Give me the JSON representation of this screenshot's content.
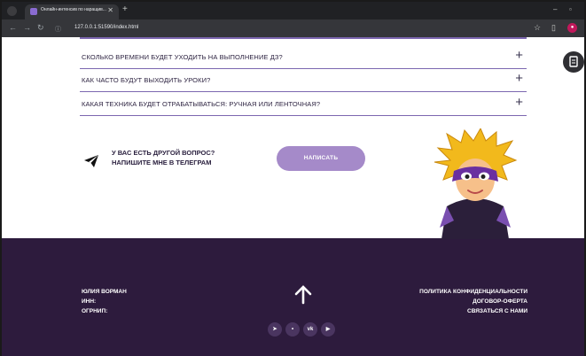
{
  "browser": {
    "tab_title": "Онлайн-интенсив по наращив...",
    "url": "127.0.0.1:51590/index.html"
  },
  "faq": [
    {
      "question": "СКОЛЬКО ВРЕМЕНИ БУДЕТ УХОДИТЬ НА ВЫПОЛНЕНИЕ ДЗ?"
    },
    {
      "question": "КАК ЧАСТО БУДУТ ВЫХОДИТЬ УРОКИ?"
    },
    {
      "question": "КАКАЯ ТЕХНИКА БУДЕТ ОТРАБАТЫВАТЬСЯ: РУЧНАЯ ИЛИ ЛЕНТОЧНАЯ?"
    }
  ],
  "contact": {
    "line1": "У ВАС ЕСТЬ ДРУГОЙ ВОПРОС?",
    "line2": "НАПИШИТЕ МНЕ В ТЕЛЕГРАМ",
    "button": "НАПИСАТЬ"
  },
  "footer": {
    "name": "ЮЛИЯ ВОРМАН",
    "inn": "ИНН:",
    "ogrnip": "ОГРНИП:",
    "links": [
      "ПОЛИТИКА КОНФИДЕНЦИАЛЬНОСТИ",
      "ДОГОВОР-ОФЕРТА",
      "СВЯЗАТЬСЯ С НАМИ"
    ],
    "socials": [
      "telegram-icon",
      "dot-icon",
      "vk-icon",
      "youtube-icon"
    ]
  },
  "colors": {
    "accent": "#a58ac9",
    "footer_bg": "#2d1b3d",
    "divider": "#7c67b0"
  }
}
